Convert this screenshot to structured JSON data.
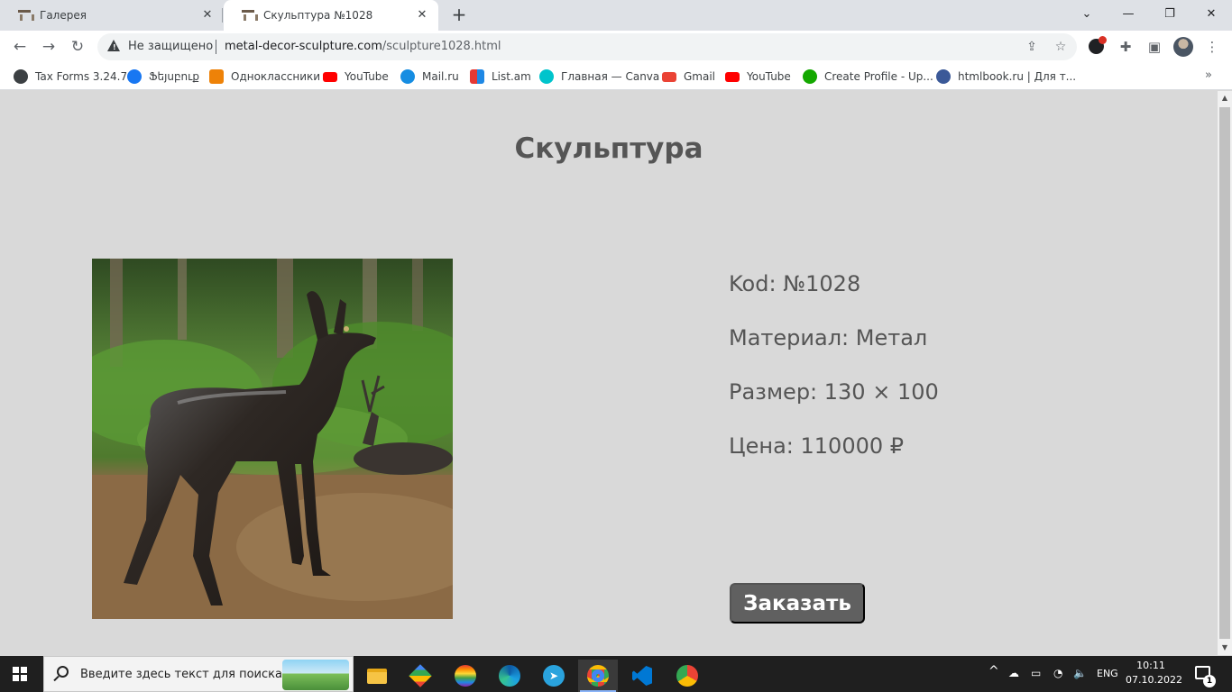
{
  "browser": {
    "tabs": [
      {
        "title": "Галерея",
        "active": false
      },
      {
        "title": "Скульптура №1028",
        "active": true
      }
    ],
    "new_tab_label": "+",
    "security_label": "Не защищено",
    "url_domain": "metal-decor-sculpture.com",
    "url_path": "/sculpture1028.html",
    "bookmarks": [
      {
        "label": "Tax Forms 3.24.7",
        "icon": "globe-icon",
        "color": "#3c4043"
      },
      {
        "label": "Ֆեյսբուք",
        "icon": "facebook-icon",
        "color": "#1877f2"
      },
      {
        "label": "Одноклассники",
        "icon": "odnoklassniki-icon",
        "color": "#ee8208"
      },
      {
        "label": "YouTube",
        "icon": "youtube-icon",
        "color": "#ff0000"
      },
      {
        "label": "Mail.ru",
        "icon": "mailru-icon",
        "color": "#168de2"
      },
      {
        "label": "List.am",
        "icon": "listam-icon",
        "color": "#f2a900"
      },
      {
        "label": "Главная — Canva",
        "icon": "canva-icon",
        "color": "#00c4cc"
      },
      {
        "label": "Gmail",
        "icon": "gmail-icon",
        "color": "#ea4335"
      },
      {
        "label": "YouTube",
        "icon": "youtube-icon",
        "color": "#ff0000"
      },
      {
        "label": "Create Profile - Up...",
        "icon": "upwork-icon",
        "color": "#14a800"
      },
      {
        "label": "htmlbook.ru | Для т...",
        "icon": "htmlbook-icon",
        "color": "#3b5998"
      }
    ]
  },
  "page": {
    "title": "Скульптура",
    "code": "Kod: №1028",
    "material": "Материал: Метал",
    "size": "Размер: 130 × 100",
    "price": "Цена: 110000 ₽",
    "order_button": "Заказать",
    "background": "#d9d9d9"
  },
  "taskbar": {
    "search_placeholder": "Введите здесь текст для поиска",
    "language": "ENG",
    "time": "10:11",
    "date": "07.10.2022",
    "notifications": "1"
  }
}
